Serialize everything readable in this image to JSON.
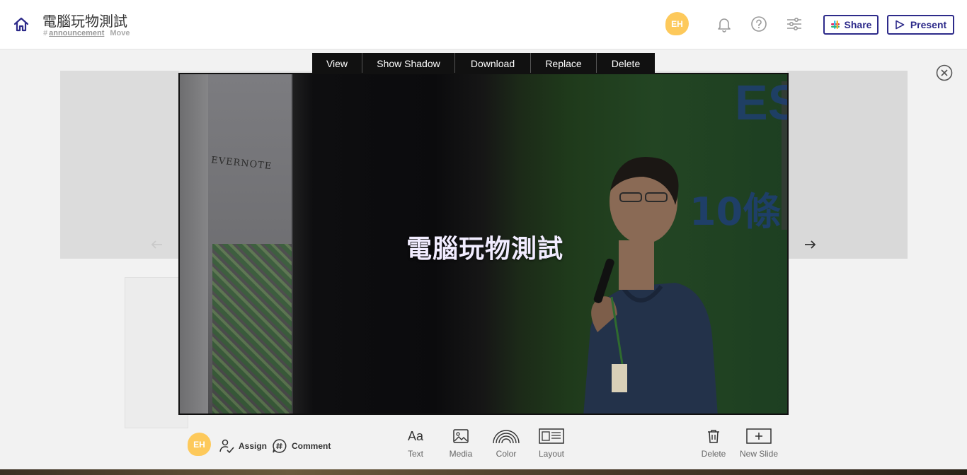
{
  "header": {
    "title": "電腦玩物測試",
    "channel_hash": "#",
    "channel": "announcement",
    "move_label": "Move",
    "avatar_initials": "EH",
    "share_label": "Share",
    "present_label": "Present"
  },
  "lightbox": {
    "toolbar": [
      "View",
      "Show Shadow",
      "Download",
      "Replace",
      "Delete"
    ],
    "image_title": "電腦玩物測試",
    "banner_text": "EVERNOTE",
    "screen_text": "10條",
    "screen_top_text": "ES"
  },
  "bottom_bar": {
    "avatar_initials": "EH",
    "assign_label": "Assign",
    "comment_label": "Comment",
    "tools": {
      "text_icon": "Aa",
      "text": "Text",
      "media": "Media",
      "color": "Color",
      "layout": "Layout",
      "delete": "Delete",
      "new_slide": "New Slide"
    }
  },
  "colors": {
    "brand": "#2d2a8a",
    "avatar": "#fdc95b"
  },
  "icons": [
    "home-icon",
    "bell-icon",
    "help-icon",
    "settings-sliders-icon",
    "slack-icon",
    "play-icon",
    "close-circle-icon",
    "arrow-left-icon",
    "arrow-right-icon",
    "assign-icon",
    "comment-icon",
    "media-icon",
    "color-rainbow-icon",
    "layout-icon",
    "trash-icon",
    "new-slide-icon"
  ]
}
